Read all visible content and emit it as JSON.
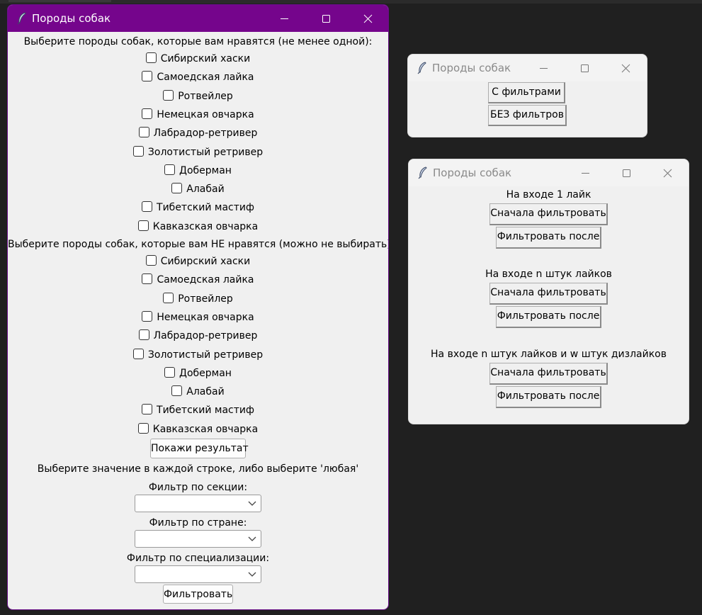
{
  "main_window": {
    "title": "Породы собак",
    "likes_prompt": "Выберите породы собак, которые вам нравятся (не менее одной):",
    "dislikes_prompt": "Выберите породы собак, которые вам НЕ нравятся (можно не выбирать):",
    "breeds": [
      "Сибирский хаски",
      "Самоедская лайка",
      "Ротвейлер",
      "Немецкая овчарка",
      "Лабрадор-ретривер",
      "Золотистый ретривер",
      "Доберман",
      "Алабай",
      "Тибетский мастиф",
      "Кавказская овчарка"
    ],
    "show_result_label": "Покажи результат",
    "filter_prompt": "Выберите значение в каждой строке, либо выберите 'любая'",
    "section_filter_label": "Фильтр по секции:",
    "country_filter_label": "Фильтр по стране:",
    "spec_filter_label": "Фильтр по специализации:",
    "section_value": "",
    "country_value": "",
    "spec_value": "",
    "filter_button_label": "Фильтровать"
  },
  "mode_window": {
    "title": "Породы собак",
    "with_filters_label": "С фильтрами",
    "without_filters_label": "БЕЗ фильтров"
  },
  "input_window": {
    "title": "Породы собак",
    "groups": [
      {
        "heading": "На входе 1 лайк",
        "filter_first": "Сначала фильтровать",
        "filter_after": "Фильтровать после"
      },
      {
        "heading": "На входе n штук лайков",
        "filter_first": "Сначала фильтровать",
        "filter_after": "Фильтровать после"
      },
      {
        "heading": "На входе n штук лайков и w штук дизлайков",
        "filter_first": "Сначала фильтровать",
        "filter_after": "Фильтровать после"
      }
    ]
  },
  "colors": {
    "active_titlebar": "#75058c",
    "window_bg": "#f0f0f0",
    "desktop_bg": "#202020"
  }
}
